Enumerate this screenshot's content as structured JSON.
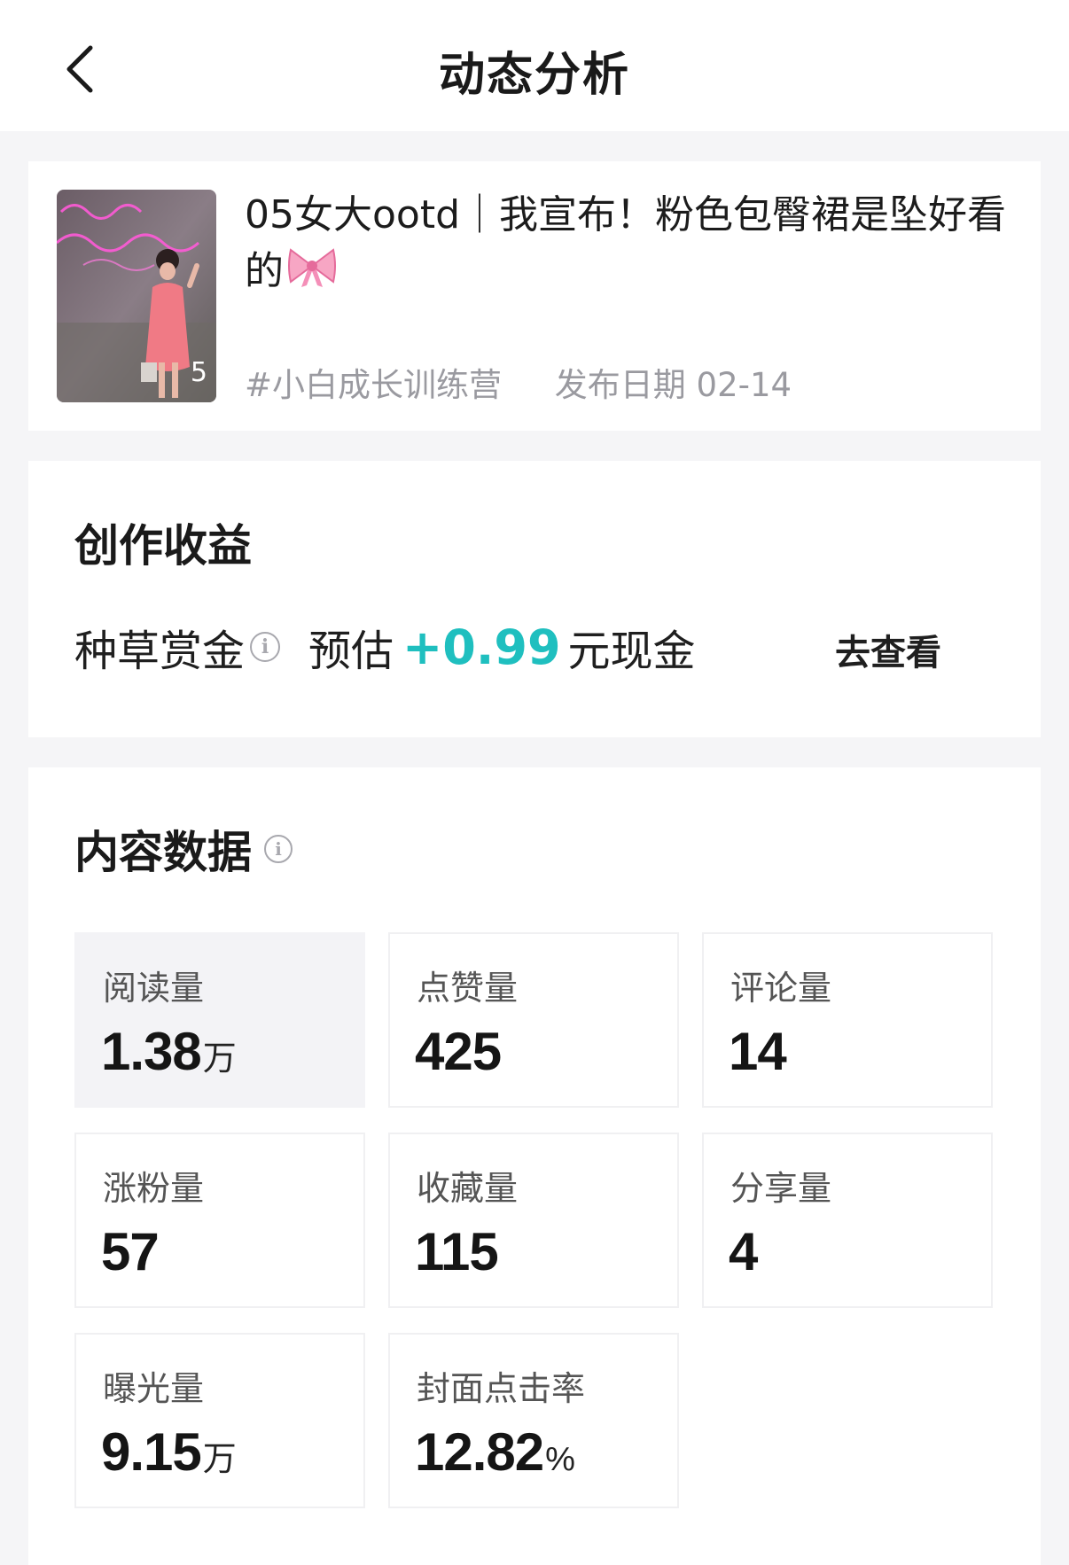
{
  "header": {
    "title": "动态分析",
    "back_icon": "chevron-left-icon"
  },
  "post": {
    "title": "05女大ootd｜我宣布！粉色包臀裙是坠好看的",
    "emoji": "bow-icon",
    "hashtag": "#小白成长训练营",
    "date": "发布日期 02-14",
    "thumb_badge": "5"
  },
  "earnings": {
    "title": "创作收益",
    "label": "种草赏金",
    "estimate_prefix": "预估",
    "amount": "+0.99",
    "suffix": "元现金",
    "action": "去查看",
    "accent_color": "#1fbfbf"
  },
  "content_data": {
    "title": "内容数据",
    "stats": [
      {
        "label": "阅读量",
        "value": "1.38",
        "unit": "万"
      },
      {
        "label": "点赞量",
        "value": "425",
        "unit": ""
      },
      {
        "label": "评论量",
        "value": "14",
        "unit": ""
      },
      {
        "label": "涨粉量",
        "value": "57",
        "unit": ""
      },
      {
        "label": "收藏量",
        "value": "115",
        "unit": ""
      },
      {
        "label": "分享量",
        "value": "4",
        "unit": ""
      },
      {
        "label": "曝光量",
        "value": "9.15",
        "unit": "万"
      },
      {
        "label": "封面点击率",
        "value": "12.82",
        "unit": "%"
      }
    ]
  }
}
